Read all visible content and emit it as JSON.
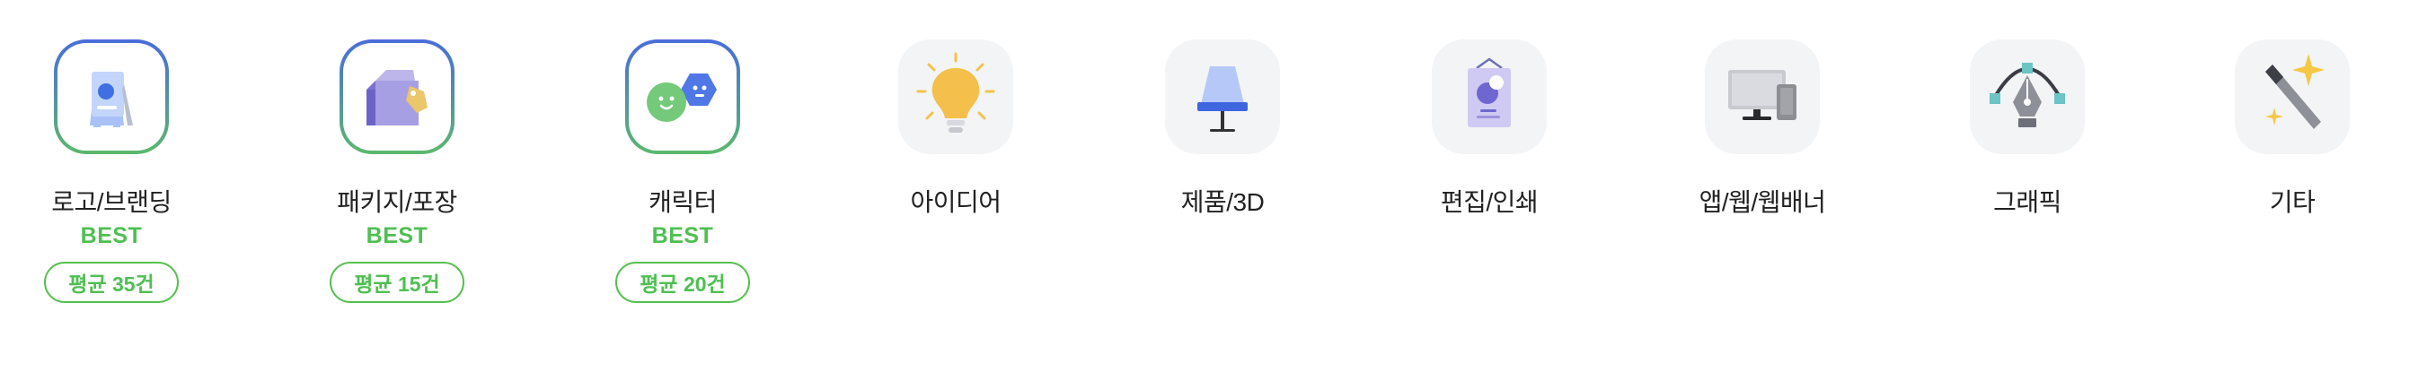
{
  "categories": [
    {
      "label": "로고/브랜딩",
      "badge": "BEST",
      "average": "평균 35건",
      "icon": "signboard-icon"
    },
    {
      "label": "패키지/포장",
      "badge": "BEST",
      "average": "평균 15건",
      "icon": "package-icon"
    },
    {
      "label": "캐릭터",
      "badge": "BEST",
      "average": "평균 20건",
      "icon": "character-faces-icon"
    },
    {
      "label": "아이디어",
      "icon": "lightbulb-icon"
    },
    {
      "label": "제품/3D",
      "icon": "lamp-icon"
    },
    {
      "label": "편집/인쇄",
      "icon": "poster-icon"
    },
    {
      "label": "앱/웹/웹배너",
      "icon": "monitor-phone-icon"
    },
    {
      "label": "그래픽",
      "icon": "pen-tool-icon"
    },
    {
      "label": "기타",
      "icon": "magic-wand-icon"
    }
  ],
  "colors": {
    "best_green": "#4fbf52",
    "gradient_top": "#4a6cdc",
    "gradient_bottom": "#5bb86d",
    "tile_gray": "#f3f4f6"
  }
}
